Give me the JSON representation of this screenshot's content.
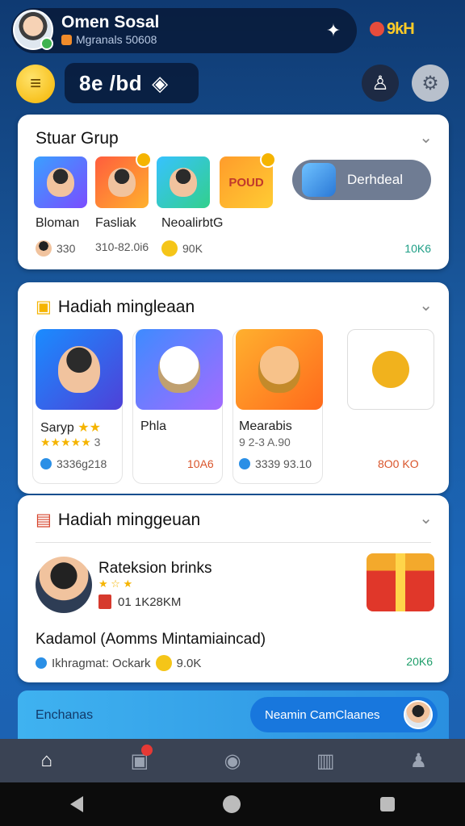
{
  "header": {
    "profile_name": "Omen Sosal",
    "profile_sub": "Mgranals 50608",
    "brand": "9kH",
    "search_text": "8e /bd"
  },
  "group_card": {
    "title": "Stuar Grup",
    "thumbs": [
      {
        "name": "Bloman"
      },
      {
        "name": "Fasliak"
      },
      {
        "name": "NeoalirbtG"
      },
      {
        "label": "POUD"
      }
    ],
    "stat_1": "330",
    "stat_2": "310-82.0i6",
    "stat_3": "90K",
    "download_label": "Derhdeal",
    "stat_right": "10K6"
  },
  "reward_card": {
    "title": "Hadiah mingleaan",
    "tiles": [
      {
        "title": "Saryp",
        "sub": "3",
        "stat": "3336g218",
        "stat_r": "10A6"
      },
      {
        "title": "Phla",
        "sub": "",
        "stat": "",
        "stat_r": ""
      },
      {
        "title": "Mearabis",
        "sub": "9 2-3 A.90",
        "stat": "3339 93.10",
        "stat_r": "8O0 KO"
      }
    ]
  },
  "weekly_card": {
    "title": "Hadiah minggeuan",
    "promo_title": "Rateksion brinks",
    "promo_meta": "01   1K28KM",
    "promo_desc": "Kadamol (Aomms Mintamiaincad)",
    "promo_bottom": "Ikhragmat: Ockark",
    "promo_bottom_2": "9.0K",
    "promo_stat": "20K6"
  },
  "banner": {
    "text": "Enchanas",
    "button": "Neamin CamClaanes"
  },
  "nav": {
    "items": [
      "home-icon",
      "ticket-icon",
      "game-icon",
      "bars-icon",
      "profile-icon"
    ]
  },
  "colors": {
    "background": "#1a5aa0",
    "accent": "#1877dd",
    "card": "#ffffff"
  }
}
